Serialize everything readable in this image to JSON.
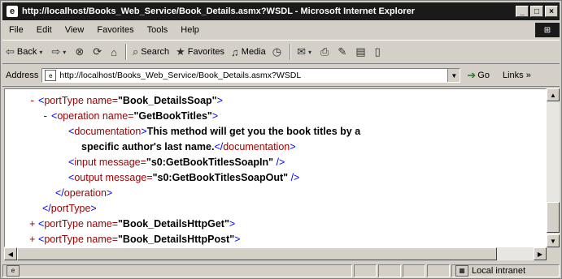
{
  "window": {
    "title": "http://localhost/Books_Web_Service/Book_Details.asmx?WSDL - Microsoft Internet Explorer",
    "caption_buttons": [
      "_",
      "□",
      "×"
    ]
  },
  "menu": [
    "File",
    "Edit",
    "View",
    "Favorites",
    "Tools",
    "Help"
  ],
  "toolbar": {
    "back": "Back",
    "search": "Search",
    "favorites": "Favorites",
    "media": "Media"
  },
  "address": {
    "label": "Address",
    "url": "http://localhost/Books_Web_Service/Book_Details.asmx?WSDL",
    "go": "Go",
    "links": "Links"
  },
  "xml": {
    "line1": {
      "marker": "-",
      "open": "<",
      "tag": "portType",
      "attr": " name=",
      "value": "\"Book_DetailsSoap\"",
      "close": ">"
    },
    "line2": {
      "marker": "-",
      "open": "<",
      "tag": "operation",
      "attr": " name=",
      "value": "\"GetBookTitles\"",
      "close": ">"
    },
    "line3": {
      "open": "<",
      "tag": "documentation",
      "close": ">",
      "text": "This method will get you the book titles by a"
    },
    "line4": {
      "text": "specific author's last name.",
      "open": "</",
      "tag": "documentation",
      "close": ">"
    },
    "line5": {
      "open": "<",
      "tag": "input",
      "attr": " message=",
      "value": "\"s0:GetBookTitlesSoapIn\"",
      "close": " />"
    },
    "line6": {
      "open": "<",
      "tag": "output",
      "attr": " message=",
      "value": "\"s0:GetBookTitlesSoapOut\"",
      "close": " />"
    },
    "line7": {
      "open": "</",
      "tag": "operation",
      "close": ">"
    },
    "line8": {
      "open": "</",
      "tag": "portType",
      "close": ">"
    },
    "line9": {
      "marker": "+",
      "open": "<",
      "tag": "portType",
      "attr": " name=",
      "value": "\"Book_DetailsHttpGet\"",
      "close": ">"
    },
    "line10": {
      "marker": "+",
      "open": "<",
      "tag": "portType",
      "attr": " name=",
      "value": "\"Book_DetailsHttpPost\"",
      "close": ">"
    }
  },
  "status": {
    "zone": "Local intranet"
  },
  "colors": {
    "tag": "#990000",
    "punct": "#0000ff",
    "value": "#000000",
    "titlebar": "#1a1a1a"
  }
}
